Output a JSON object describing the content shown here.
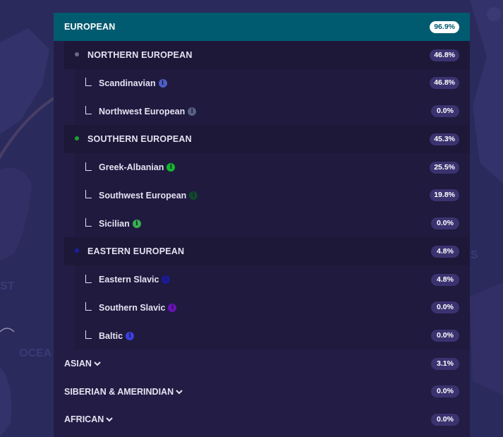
{
  "top": {
    "label": "EUROPEAN",
    "percent": "96.9%"
  },
  "regions": [
    {
      "label": "NORTHERN EUROPEAN",
      "percent": "46.8%",
      "dot_color": "#6b6a8a",
      "items": [
        {
          "label": "Scandinavian",
          "percent": "46.8%",
          "icon_color": "#4f5fc7",
          "icon": "info-icon"
        },
        {
          "label": "Northwest European",
          "percent": "0.0%",
          "icon_color": "#5a5f86",
          "icon": "info-icon"
        }
      ]
    },
    {
      "label": "SOUTHERN EUROPEAN",
      "percent": "45.3%",
      "dot_color": "#1aa32b",
      "items": [
        {
          "label": "Greek-Albanian",
          "percent": "25.5%",
          "icon_color": "#14b82a",
          "icon": "info-icon"
        },
        {
          "label": "Southwest European",
          "percent": "19.8%",
          "icon_color": "#0f4a2a",
          "icon": "info-icon"
        },
        {
          "label": "Sicilian",
          "percent": "0.0%",
          "icon_color": "#35b24d",
          "icon": "info-icon"
        }
      ]
    },
    {
      "label": "EASTERN EUROPEAN",
      "percent": "4.8%",
      "dot_color": "#1b1ea8",
      "items": [
        {
          "label": "Eastern Slavic",
          "percent": "4.8%",
          "icon_color": "#1a1a9a",
          "icon": "info-icon"
        },
        {
          "label": "Southern Slavic",
          "percent": "0.0%",
          "icon_color": "#6a12b8",
          "icon": "info-icon"
        },
        {
          "label": "Baltic",
          "percent": "0.0%",
          "icon_color": "#3d3fe0",
          "icon": "info-icon"
        }
      ]
    }
  ],
  "collapsed": [
    {
      "label": "ASIAN",
      "percent": "3.1%"
    },
    {
      "label": "SIBERIAN & AMERINDIAN",
      "percent": "0.0%"
    },
    {
      "label": "AFRICAN",
      "percent": "0.0%"
    }
  ],
  "background_text": {
    "left_a": "ST",
    "left_b": "OCEA",
    "right": "S"
  },
  "colors": {
    "accent": "#005a70",
    "panel": "#231d45",
    "page": "#2b2a5c"
  }
}
